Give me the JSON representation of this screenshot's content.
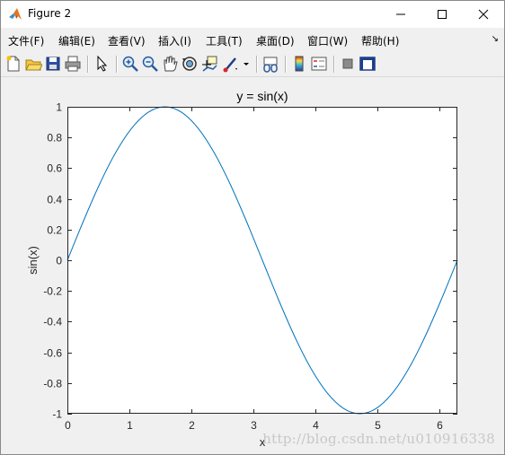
{
  "window": {
    "title": "Figure 2",
    "controls": {
      "minimize": "—",
      "maximize": "☐",
      "close": "✕"
    }
  },
  "menubar": {
    "items": [
      {
        "label": "文件(F)"
      },
      {
        "label": "编辑(E)"
      },
      {
        "label": "查看(V)"
      },
      {
        "label": "插入(I)"
      },
      {
        "label": "工具(T)"
      },
      {
        "label": "桌面(D)"
      },
      {
        "label": "窗口(W)"
      },
      {
        "label": "帮助(H)"
      }
    ],
    "expand_glyph": "↘"
  },
  "toolbar": {
    "buttons": [
      {
        "icon": "new-figure-icon"
      },
      {
        "icon": "open-file-icon"
      },
      {
        "icon": "save-icon"
      },
      {
        "icon": "print-icon"
      },
      {
        "icon": "edit-plot-icon"
      },
      {
        "icon": "zoom-in-icon"
      },
      {
        "icon": "zoom-out-icon"
      },
      {
        "icon": "pan-icon"
      },
      {
        "icon": "rotate-3d-icon"
      },
      {
        "icon": "data-cursor-icon"
      },
      {
        "icon": "brush-icon"
      },
      {
        "icon": "link-plot-icon"
      },
      {
        "icon": "insert-colorbar-icon"
      },
      {
        "icon": "insert-legend-icon"
      },
      {
        "icon": "hide-plot-tools-icon"
      },
      {
        "icon": "show-plot-tools-icon"
      }
    ]
  },
  "chart_data": {
    "type": "line",
    "title": "y = sin(x)",
    "xlabel": "x",
    "ylabel": "sin(x)",
    "xlim": [
      0,
      6.2832
    ],
    "ylim": [
      -1,
      1
    ],
    "xticks": [
      "0",
      "1",
      "2",
      "3",
      "4",
      "5",
      "6"
    ],
    "yticks": [
      "-1",
      "-0.8",
      "-0.6",
      "-0.4",
      "-0.2",
      "0",
      "0.2",
      "0.4",
      "0.6",
      "0.8",
      "1"
    ],
    "grid": false,
    "series": [
      {
        "color": "#0072bd",
        "x": [
          0,
          0.2618,
          0.5236,
          0.7854,
          1.0472,
          1.309,
          1.5708,
          1.8326,
          2.0944,
          2.3562,
          2.618,
          2.8798,
          3.1416,
          3.4034,
          3.6652,
          3.927,
          4.1888,
          4.4506,
          4.7124,
          4.9742,
          5.236,
          5.4978,
          5.7596,
          6.0214,
          6.2832
        ],
        "y": [
          0,
          0.2588,
          0.5,
          0.7071,
          0.866,
          0.9659,
          1,
          0.9659,
          0.866,
          0.7071,
          0.5,
          0.2588,
          0,
          -0.2588,
          -0.5,
          -0.7071,
          -0.866,
          -0.9659,
          -1,
          -0.9659,
          -0.866,
          -0.7071,
          -0.5,
          -0.2588,
          0
        ]
      }
    ]
  },
  "watermark": "http://blog.csdn.net/u010916338"
}
